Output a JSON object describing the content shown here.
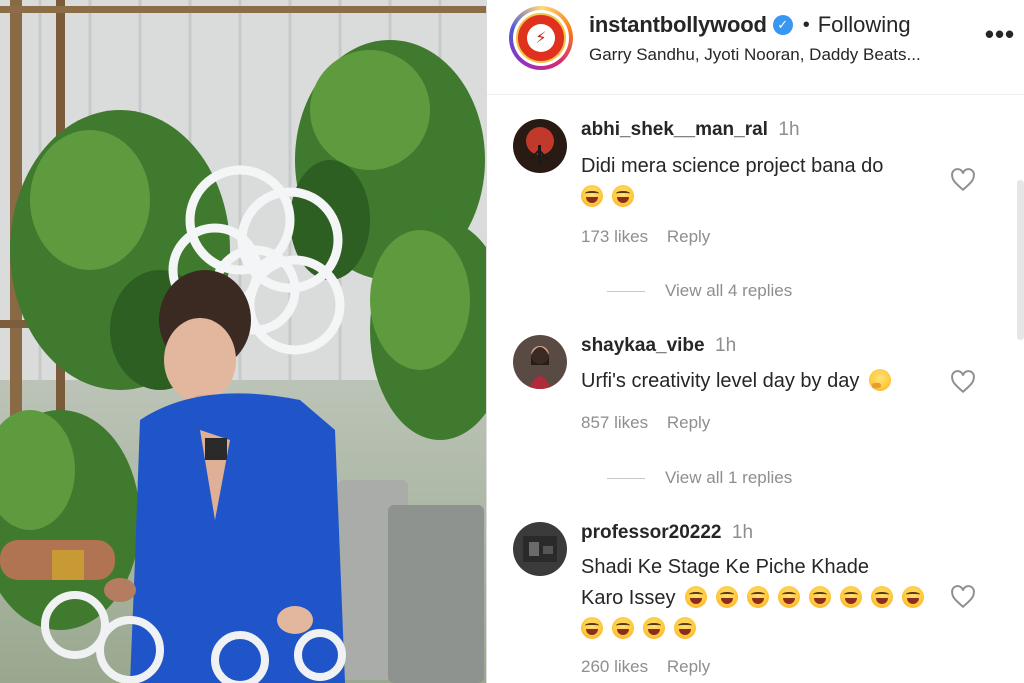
{
  "post": {
    "username": "instantbollywood",
    "separator": "•",
    "follow_state": "Following",
    "audio": "Garry Sandhu, Jyoti Nooran, Daddy Beats...",
    "more_label": "•••"
  },
  "comments": [
    {
      "user": "abhi_shek__man_ral",
      "time": "1h",
      "text": "Didi mera science project bana do",
      "emoji_count": 2,
      "likes": "173 likes",
      "reply": "Reply",
      "view_replies": "View all 4 replies"
    },
    {
      "user": "shaykaa_vibe",
      "time": "1h",
      "text": "Urfi's creativity level day by day",
      "likes": "857 likes",
      "reply": "Reply",
      "view_replies": "View all 1 replies"
    },
    {
      "user": "professor20222",
      "time": "1h",
      "text_line1": "Shadi Ke Stage Ke Piche Khade",
      "text_line2": "Karo Issey",
      "emoji_count": 12,
      "likes": "260 likes",
      "reply": "Reply"
    }
  ],
  "icons": {
    "verified": "verified-badge-icon",
    "like": "heart-outline-icon",
    "more": "more-options-icon"
  },
  "colors": {
    "text": "#262626",
    "muted": "#8e8e8e",
    "verified": "#3897f0",
    "blazer": "#1f55c9"
  }
}
